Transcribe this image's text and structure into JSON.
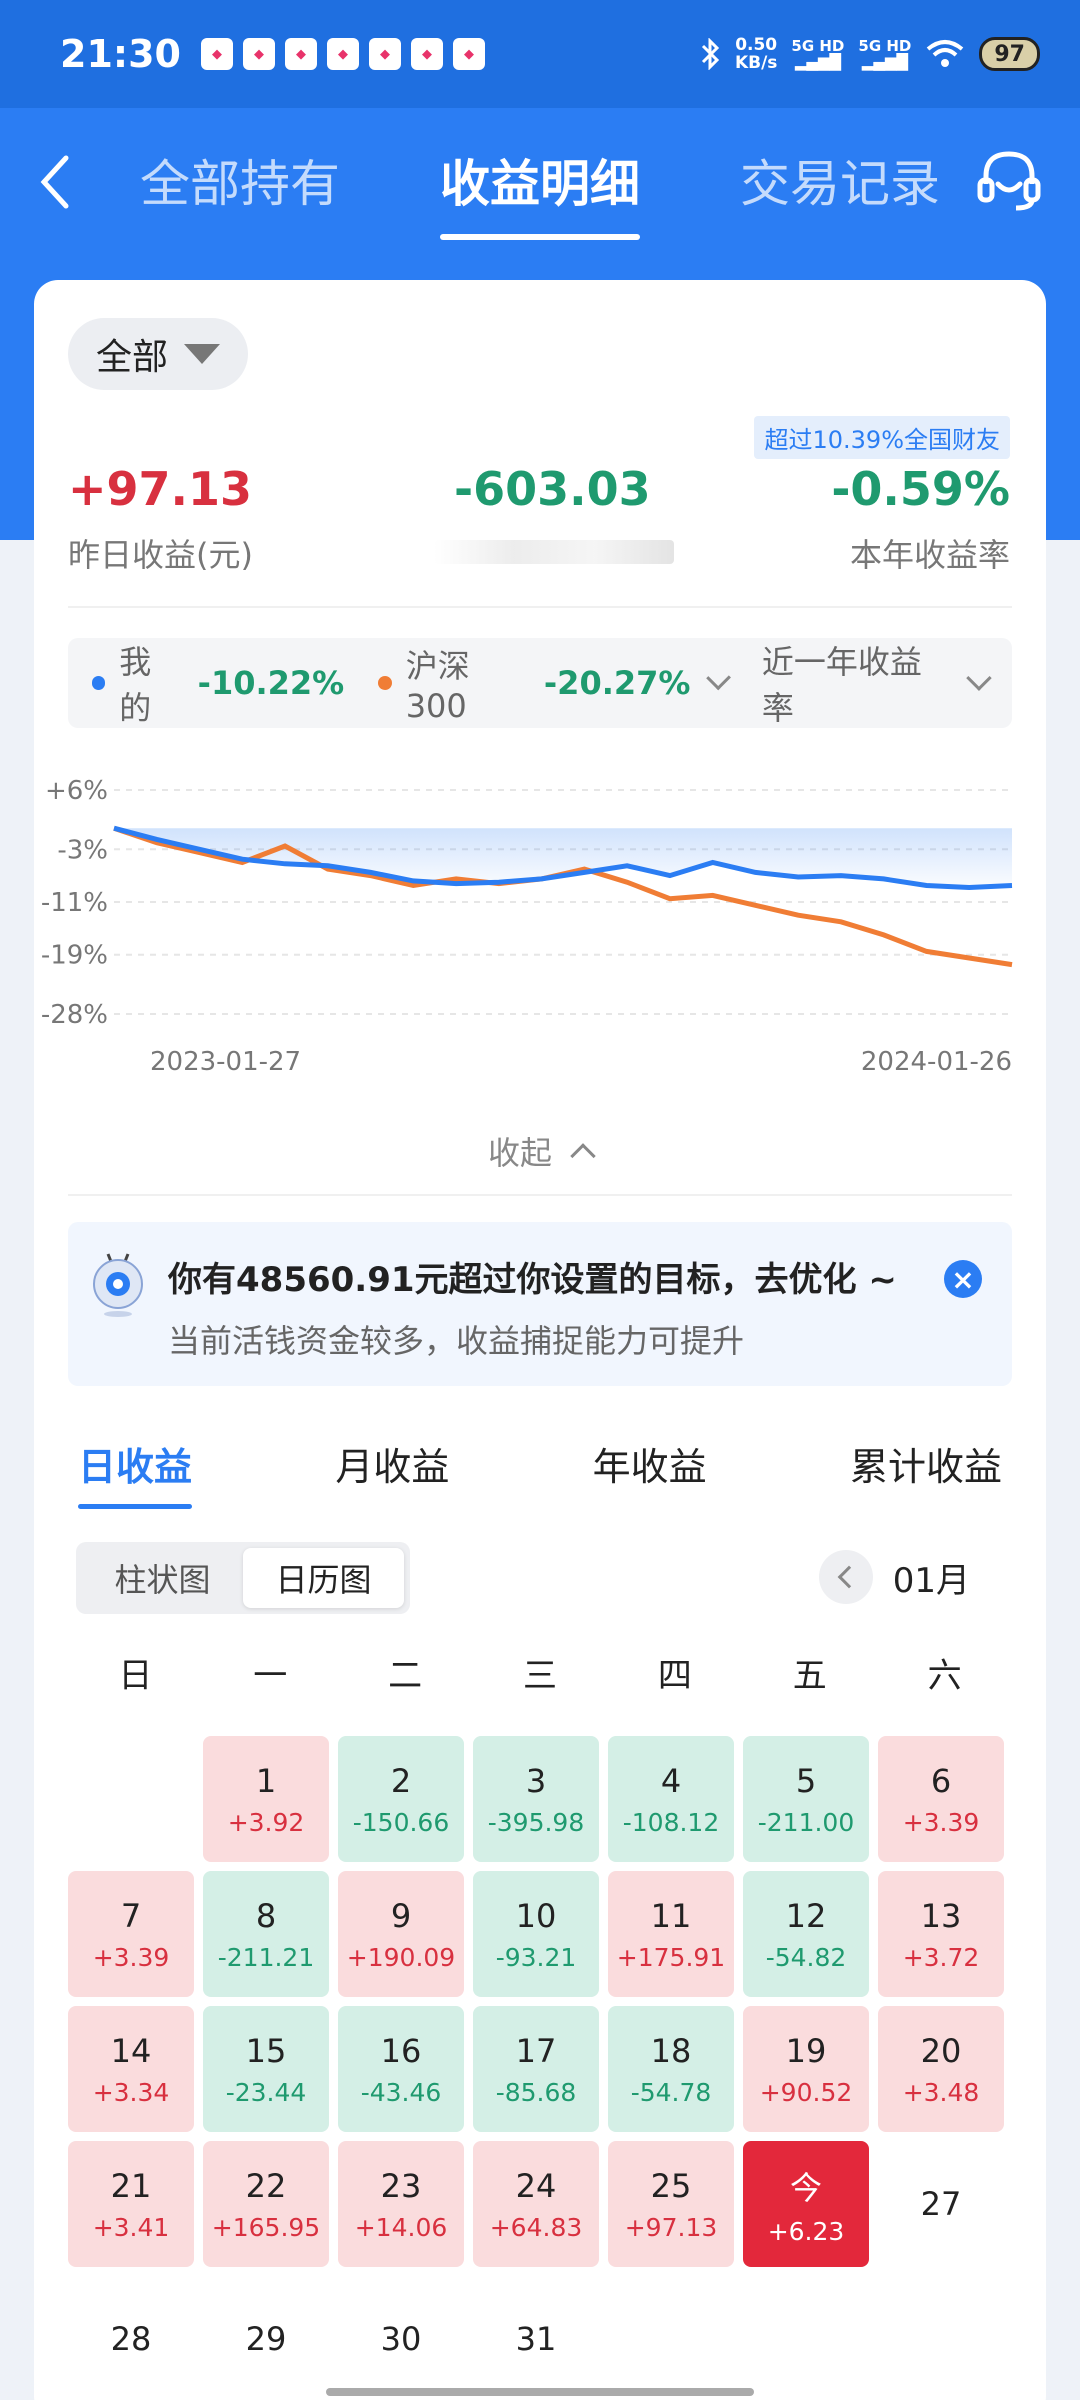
{
  "status": {
    "time": "21:30",
    "net_speed_value": "0.50",
    "net_speed_unit": "KB/s",
    "signal1": "5G HD",
    "signal2": "5G HD",
    "battery": "97"
  },
  "nav": {
    "tabs": [
      "全部持有",
      "收益明细",
      "交易记录"
    ],
    "active_index": 1
  },
  "filter": {
    "label": "全部"
  },
  "rank_badge": "超过10.39%全国财友",
  "stats": {
    "yesterday_value": "+97.13",
    "yesterday_label": "昨日收益(元)",
    "middle_value": "-603.03",
    "ytd_rate_value": "-0.59%",
    "ytd_rate_label": "本年收益率"
  },
  "compare": {
    "mine_label": "我的",
    "mine_value": "-10.22%",
    "bench_label": "沪深300",
    "bench_value": "-20.27%",
    "period_label": "近一年收益率"
  },
  "chart_data": {
    "type": "line",
    "y_ticks": [
      "+6%",
      "-3%",
      "-11%",
      "-19%",
      "-28%"
    ],
    "y_tick_values": [
      6,
      -3,
      -11,
      -19,
      -28
    ],
    "ylim": [
      -28,
      6
    ],
    "x_ticks": [
      "2023-01-27",
      "2024-01-26"
    ],
    "x": [
      0,
      12,
      24,
      36,
      48,
      60,
      72,
      84,
      96,
      108,
      120,
      132,
      144,
      156,
      168,
      180,
      192,
      204,
      216,
      228,
      240,
      252
    ],
    "series": [
      {
        "name": "我的",
        "color": "#2b7df3",
        "values": [
          0.2,
          -1.5,
          -3.0,
          -4.5,
          -5.2,
          -5.5,
          -6.5,
          -7.8,
          -8.2,
          -8.0,
          -7.5,
          -6.5,
          -5.5,
          -7.0,
          -5.0,
          -6.5,
          -7.2,
          -7.0,
          -7.5,
          -8.5,
          -8.8,
          -8.5
        ]
      },
      {
        "name": "沪深300",
        "color": "#f07d35",
        "values": [
          0.2,
          -2.0,
          -3.5,
          -5.0,
          -2.5,
          -6.0,
          -7.0,
          -8.5,
          -7.5,
          -8.2,
          -7.5,
          -6.0,
          -8.0,
          -10.5,
          -10.0,
          -11.5,
          -13.0,
          -14.0,
          -16.0,
          -18.5,
          -19.5,
          -20.5
        ]
      }
    ]
  },
  "collapse_label": "收起",
  "tip": {
    "title": "你有48560.91元超过你设置的目标，去优化 ~",
    "subtitle": "当前活钱资金较多，收益捕捉能力可提升",
    "close": "×"
  },
  "income_tabs": [
    "日收益",
    "月收益",
    "年收益",
    "累计收益"
  ],
  "view_toggle": [
    "柱状图",
    "日历图"
  ],
  "month": "01月",
  "weekdays": [
    "日",
    "一",
    "二",
    "三",
    "四",
    "五",
    "六"
  ],
  "calendar": [
    {
      "d": "",
      "v": "",
      "t": "blank"
    },
    {
      "d": "1",
      "v": "+3.92",
      "t": "up"
    },
    {
      "d": "2",
      "v": "-150.66",
      "t": "down"
    },
    {
      "d": "3",
      "v": "-395.98",
      "t": "down"
    },
    {
      "d": "4",
      "v": "-108.12",
      "t": "down"
    },
    {
      "d": "5",
      "v": "-211.00",
      "t": "down"
    },
    {
      "d": "6",
      "v": "+3.39",
      "t": "up"
    },
    {
      "d": "7",
      "v": "+3.39",
      "t": "up"
    },
    {
      "d": "8",
      "v": "-211.21",
      "t": "down"
    },
    {
      "d": "9",
      "v": "+190.09",
      "t": "up"
    },
    {
      "d": "10",
      "v": "-93.21",
      "t": "down"
    },
    {
      "d": "11",
      "v": "+175.91",
      "t": "up"
    },
    {
      "d": "12",
      "v": "-54.82",
      "t": "down"
    },
    {
      "d": "13",
      "v": "+3.72",
      "t": "up"
    },
    {
      "d": "14",
      "v": "+3.34",
      "t": "up"
    },
    {
      "d": "15",
      "v": "-23.44",
      "t": "down"
    },
    {
      "d": "16",
      "v": "-43.46",
      "t": "down"
    },
    {
      "d": "17",
      "v": "-85.68",
      "t": "down"
    },
    {
      "d": "18",
      "v": "-54.78",
      "t": "down"
    },
    {
      "d": "19",
      "v": "+90.52",
      "t": "up"
    },
    {
      "d": "20",
      "v": "+3.48",
      "t": "up"
    },
    {
      "d": "21",
      "v": "+3.41",
      "t": "up"
    },
    {
      "d": "22",
      "v": "+165.95",
      "t": "up"
    },
    {
      "d": "23",
      "v": "+14.06",
      "t": "up"
    },
    {
      "d": "24",
      "v": "+64.83",
      "t": "up"
    },
    {
      "d": "25",
      "v": "+97.13",
      "t": "up"
    },
    {
      "d": "今",
      "v": "+6.23",
      "t": "today"
    },
    {
      "d": "27",
      "v": "",
      "t": "blank"
    },
    {
      "d": "28",
      "v": "",
      "t": "blank"
    },
    {
      "d": "29",
      "v": "",
      "t": "blank"
    },
    {
      "d": "30",
      "v": "",
      "t": "blank"
    },
    {
      "d": "31",
      "v": "",
      "t": "blank"
    }
  ]
}
